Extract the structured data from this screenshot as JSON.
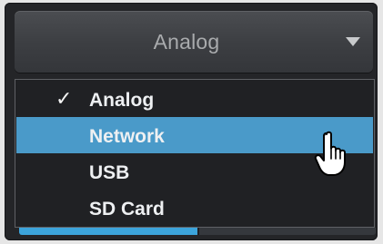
{
  "dropdown": {
    "selected_value": "Analog"
  },
  "menu": {
    "items": [
      {
        "label": "Analog",
        "checked": true,
        "hovered": false
      },
      {
        "label": "Network",
        "checked": false,
        "hovered": true
      },
      {
        "label": "USB",
        "checked": false,
        "hovered": false
      },
      {
        "label": "SD Card",
        "checked": false,
        "hovered": false
      }
    ],
    "check_mark": "✓"
  },
  "progress": {
    "fill_fraction": 0.5
  },
  "icons": {
    "dropdown_arrow": "triangle-down-icon",
    "cursor": "pointing-hand-cursor-icon"
  },
  "colors": {
    "panel_bg": "#242528",
    "button_text": "#a9abad",
    "menu_bg": "#202124",
    "menu_text": "#eef0f2",
    "highlight": "#4a9ac9",
    "progress": "#3ca4db"
  }
}
